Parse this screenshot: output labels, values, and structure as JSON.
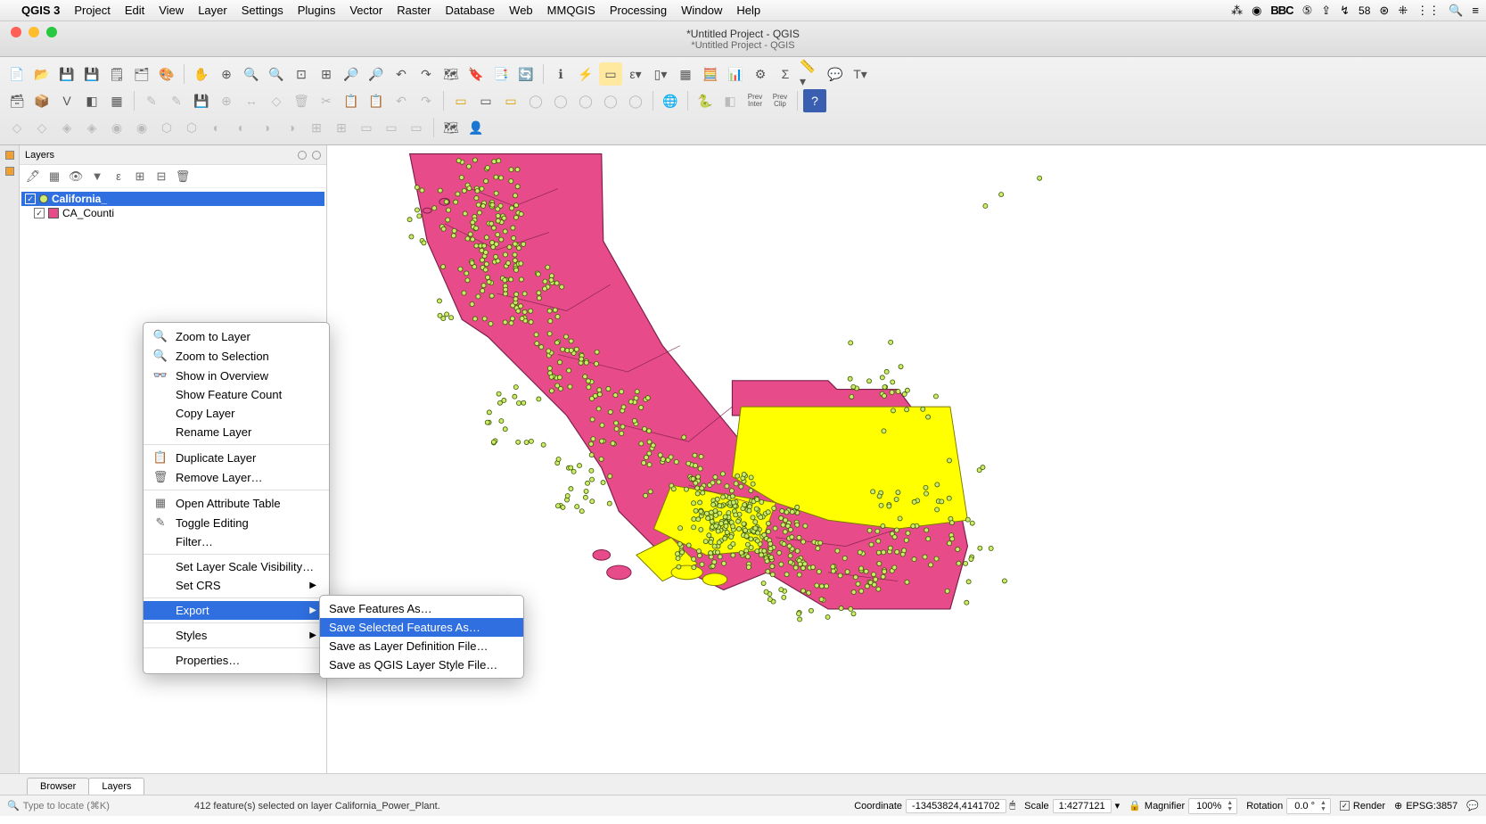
{
  "mac_menu": {
    "app": "QGIS 3",
    "items": [
      "Project",
      "Edit",
      "View",
      "Layer",
      "Settings",
      "Plugins",
      "Vector",
      "Raster",
      "Database",
      "Web",
      "MMQGIS",
      "Processing",
      "Window",
      "Help"
    ],
    "right_battery": "58"
  },
  "window": {
    "title_main": "*Untitled Project - QGIS",
    "title_sub": "*Untitled Project - QGIS"
  },
  "layers_panel": {
    "title": "Layers",
    "items": [
      {
        "name": "California_",
        "type": "point",
        "checked": true,
        "selected": true
      },
      {
        "name": "CA_Counti",
        "type": "poly",
        "checked": true,
        "selected": false
      }
    ]
  },
  "context_menu": {
    "items": [
      {
        "label": "Zoom to Layer",
        "icon": "🔍"
      },
      {
        "label": "Zoom to Selection",
        "icon": "🔍"
      },
      {
        "label": "Show in Overview",
        "icon": "👓"
      },
      {
        "label": "Show Feature Count",
        "icon": ""
      },
      {
        "label": "Copy Layer",
        "icon": ""
      },
      {
        "label": "Rename Layer",
        "icon": ""
      },
      {
        "sep": true
      },
      {
        "label": "Duplicate Layer",
        "icon": "📋"
      },
      {
        "label": "Remove Layer…",
        "icon": "🗑"
      },
      {
        "sep": true
      },
      {
        "label": "Open Attribute Table",
        "icon": "▦"
      },
      {
        "label": "Toggle Editing",
        "icon": "✎"
      },
      {
        "label": "Filter…",
        "icon": ""
      },
      {
        "sep": true
      },
      {
        "label": "Set Layer Scale Visibility…",
        "icon": ""
      },
      {
        "label": "Set CRS",
        "icon": "",
        "submenu": true
      },
      {
        "sep": true
      },
      {
        "label": "Export",
        "icon": "",
        "submenu": true,
        "hl": true
      },
      {
        "sep": true
      },
      {
        "label": "Styles",
        "icon": "",
        "submenu": true
      },
      {
        "sep": true
      },
      {
        "label": "Properties…",
        "icon": ""
      }
    ],
    "export_submenu": [
      {
        "label": "Save Features As…"
      },
      {
        "label": "Save Selected Features As…",
        "hl": true
      },
      {
        "label": "Save as Layer Definition File…"
      },
      {
        "label": "Save as QGIS Layer Style File…"
      }
    ]
  },
  "bottom_tabs": {
    "browser": "Browser",
    "layers": "Layers"
  },
  "status": {
    "locate_placeholder": "Type to locate (⌘K)",
    "message": "412 feature(s) selected on layer California_Power_Plant.",
    "coord_label": "Coordinate",
    "coord_value": "-13453824,4141702",
    "scale_label": "Scale",
    "scale_value": "1:4277121",
    "magnifier_label": "Magnifier",
    "magnifier_value": "100%",
    "rotation_label": "Rotation",
    "rotation_value": "0.0 °",
    "render_label": "Render",
    "crs": "EPSG:3857"
  }
}
